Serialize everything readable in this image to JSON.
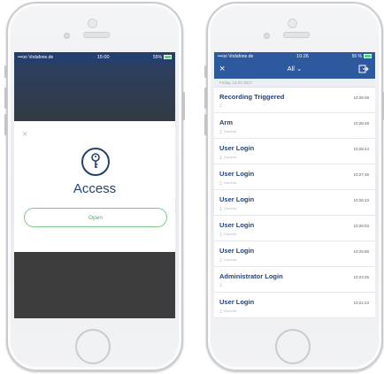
{
  "left_screen": {
    "status": {
      "carrier": "•••oo Vodafone.de",
      "time": "15:00",
      "battery": "55%"
    },
    "modal": {
      "close_label": "×",
      "title": "Access",
      "button_label": "Open"
    },
    "icons": {
      "key": "key-icon",
      "close": "close-icon"
    }
  },
  "right_screen": {
    "status": {
      "carrier": "•••oo Vodafone.de",
      "time": "10:26",
      "battery": "55 %"
    },
    "header": {
      "close_label": "×",
      "filter_label": "All ⌄"
    },
    "date_label": "Friday, 14.07.2017",
    "entries": [
      {
        "title": "Recording Triggered",
        "time": "10:28:48",
        "user": ""
      },
      {
        "title": "Arm",
        "time": "10:28:48",
        "user": "Dominik"
      },
      {
        "title": "User Login",
        "time": "10:28:44",
        "user": "Dominik"
      },
      {
        "title": "User Login",
        "time": "10:27:45",
        "user": "Dominik"
      },
      {
        "title": "User Login",
        "time": "10:26:13",
        "user": "Dominik"
      },
      {
        "title": "User Login",
        "time": "10:26:03",
        "user": "Dominik"
      },
      {
        "title": "User Login",
        "time": "10:25:56",
        "user": "Dominik"
      },
      {
        "title": "Administrator Login",
        "time": "10:23:25",
        "user": ""
      },
      {
        "title": "User Login",
        "time": "10:21:23",
        "user": "Dominik"
      }
    ]
  },
  "colors": {
    "navy": "#22436f",
    "nav_blue": "#2d5a9e",
    "green_outline": "#7dc78d",
    "green_text": "#4caa5e",
    "overlay_dark": "#3d3d3d"
  }
}
